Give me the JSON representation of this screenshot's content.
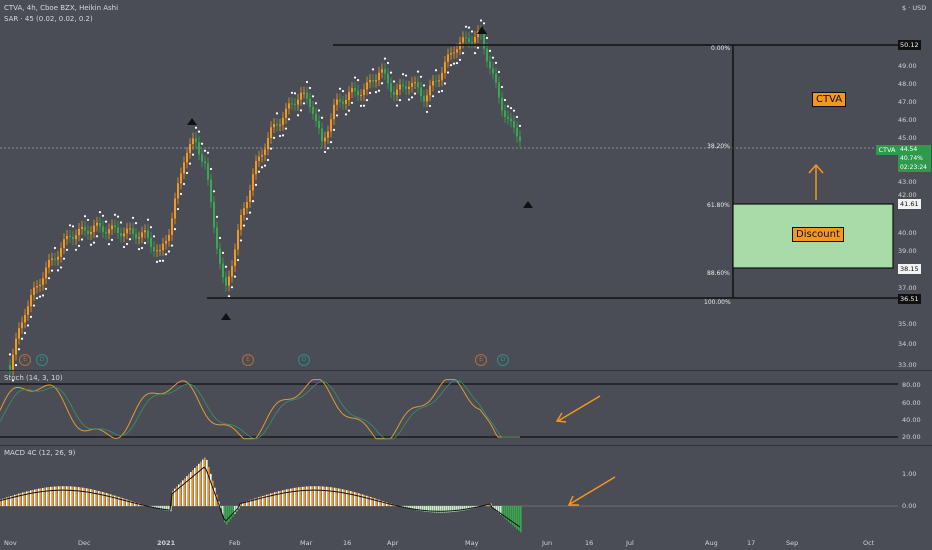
{
  "legend": {
    "symbol_line": "CTVA, 4h, Cboe BZX, Heikin Ashi",
    "sar_line": "SAR · 45 (0.02, 0.02, 0.2)",
    "stoch_line": "Stoch (14, 3, 10)",
    "macd_line": "MACD 4C (12, 26, 9)"
  },
  "top_right": "$ · USD",
  "price_axis": [
    "51.00",
    "49.00",
    "48.00",
    "47.00",
    "46.00",
    "45.00",
    "44.00",
    "43.00",
    "42.00",
    "40.00",
    "39.00",
    "37.00",
    "36.00",
    "35.00",
    "34.00",
    "33.00"
  ],
  "stoch_axis": [
    "80.00",
    "60.00",
    "40.00",
    "20.00"
  ],
  "macd_axis": [
    "1.00",
    "0.00"
  ],
  "time_axis": [
    {
      "label": "Nov",
      "bold": false
    },
    {
      "label": "Dec",
      "bold": false
    },
    {
      "label": "2021",
      "bold": true
    },
    {
      "label": "Feb",
      "bold": false
    },
    {
      "label": "Mar",
      "bold": false
    },
    {
      "label": "16",
      "bold": false
    },
    {
      "label": "Apr",
      "bold": false
    },
    {
      "label": "May",
      "bold": false
    },
    {
      "label": "Jun",
      "bold": false
    },
    {
      "label": "16",
      "bold": false
    },
    {
      "label": "Jul",
      "bold": false
    },
    {
      "label": "Aug",
      "bold": false
    },
    {
      "label": "17",
      "bold": false
    },
    {
      "label": "Sep",
      "bold": false
    },
    {
      "label": "Oct",
      "bold": false
    }
  ],
  "fib_levels": [
    "0.00%",
    "38.20%",
    "61.80%",
    "88.60%",
    "100.00%"
  ],
  "badges": {
    "high": "50.12",
    "zone_top": "41.61",
    "zone_bottom": "38.15",
    "low": "36.51"
  },
  "current_price": {
    "ticker": "CTVA",
    "price": "44.54",
    "change": "40.74%",
    "countdown": "02:23:24"
  },
  "annotations": {
    "ctva_label": "CTVA",
    "discount_label": "Discount"
  },
  "events": [
    {
      "type": "e",
      "label": "E"
    },
    {
      "type": "d",
      "label": "D"
    },
    {
      "type": "e",
      "label": "E"
    },
    {
      "type": "d",
      "label": "D"
    },
    {
      "type": "e",
      "label": "E"
    },
    {
      "type": "d",
      "label": "D"
    }
  ],
  "colors": {
    "background": "#4a4d55",
    "bull_candle": "#f5961f",
    "bear_candle": "#3aa84f",
    "sar_dot": "#ffffff",
    "zone_fill": "#a8dba8",
    "arrow": "#f5961f",
    "current_price": "#2e9a4c"
  },
  "chart_data": {
    "type": "line",
    "title": "CTVA, 4h, Cboe BZX, Heikin Ashi",
    "xlabel": "",
    "ylabel": "",
    "x": [
      "Nov",
      "Dec",
      "2021",
      "Feb",
      "Mar",
      "16",
      "Apr",
      "May"
    ],
    "series": [
      {
        "name": "CTVA",
        "values": [
          33.0,
          39.2,
          39.0,
          36.6,
          47.0,
          46.5,
          47.4,
          44.5
        ]
      }
    ],
    "ylim": [
      33,
      51
    ],
    "key_levels": {
      "high": 50.12,
      "zone_top": 41.61,
      "zone_bottom": 38.15,
      "low": 36.51,
      "last": 44.54
    },
    "grid": false
  }
}
